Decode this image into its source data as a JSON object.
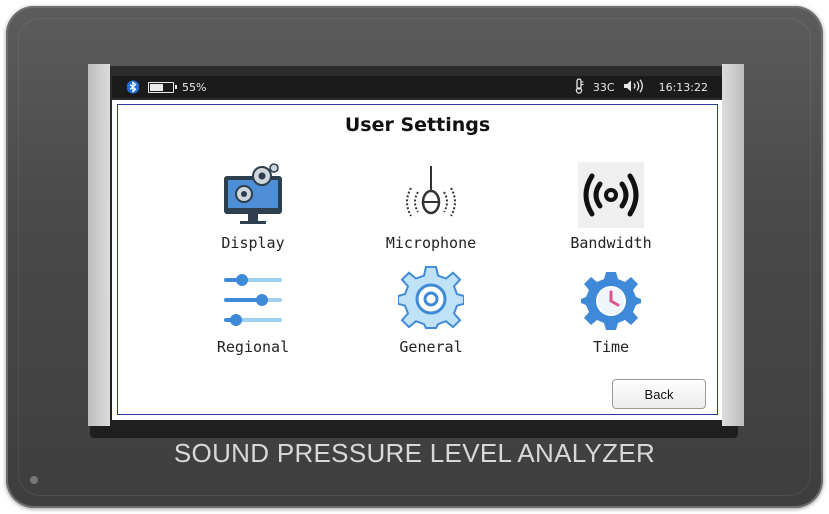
{
  "status_bar": {
    "battery_percent_text": "55%",
    "battery_level": 0.55,
    "temperature": "33C",
    "time": "16:13:22"
  },
  "screen": {
    "title": "User Settings",
    "settings": [
      {
        "label": "Display",
        "icon": "monitor-gears-icon"
      },
      {
        "label": "Microphone",
        "icon": "microphone-icon"
      },
      {
        "label": "Bandwidth",
        "icon": "signal-waves-icon"
      },
      {
        "label": "Regional",
        "icon": "sliders-icon"
      },
      {
        "label": "General",
        "icon": "gear-icon"
      },
      {
        "label": "Time",
        "icon": "clock-gear-icon"
      }
    ],
    "back_label": "Back"
  },
  "device": {
    "brand_text": "SOUND PRESSURE LEVEL ANALYZER"
  },
  "colors": {
    "frame_border": "#2b3a9f",
    "icon_blue": "#3f8ad8",
    "icon_light_blue": "#9fd0f2"
  }
}
